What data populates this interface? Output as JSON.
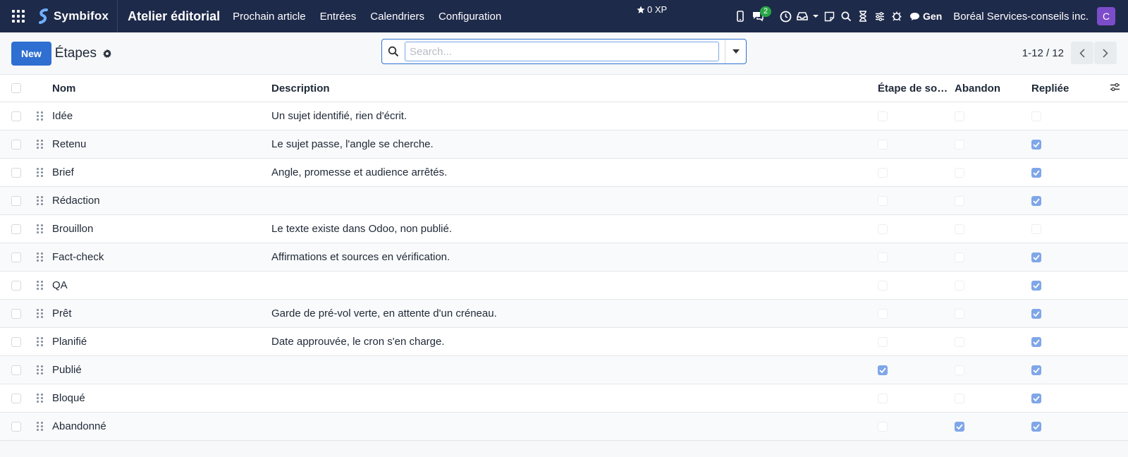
{
  "navbar": {
    "brand": "Symbifox",
    "app_name": "Atelier éditorial",
    "menu": [
      "Prochain article",
      "Entrées",
      "Calendriers",
      "Configuration"
    ],
    "xp": "0 XP",
    "chat_badge": "2",
    "gen_label": "Gen",
    "company": "Boréal Services-conseils inc.",
    "avatar": "C"
  },
  "control": {
    "new_label": "New",
    "title": "Étapes",
    "search_placeholder": "Search...",
    "pager_value": "1-12 / 12"
  },
  "table": {
    "headers": {
      "name": "Nom",
      "description": "Description",
      "exit": "Étape de sortie",
      "abandon": "Abandon",
      "folded": "Repliée"
    },
    "rows": [
      {
        "name": "Idée",
        "description": "Un sujet identifié, rien d'écrit.",
        "exit": false,
        "abandon": false,
        "folded": false
      },
      {
        "name": "Retenu",
        "description": "Le sujet passe, l'angle se cherche.",
        "exit": false,
        "abandon": false,
        "folded": true
      },
      {
        "name": "Brief",
        "description": "Angle, promesse et audience arrêtés.",
        "exit": false,
        "abandon": false,
        "folded": true
      },
      {
        "name": "Rédaction",
        "description": "",
        "exit": false,
        "abandon": false,
        "folded": true
      },
      {
        "name": "Brouillon",
        "description": "Le texte existe dans Odoo, non publié.",
        "exit": false,
        "abandon": false,
        "folded": false
      },
      {
        "name": "Fact-check",
        "description": "Affirmations et sources en vérification.",
        "exit": false,
        "abandon": false,
        "folded": true
      },
      {
        "name": "QA",
        "description": "",
        "exit": false,
        "abandon": false,
        "folded": true
      },
      {
        "name": "Prêt",
        "description": "Garde de pré-vol verte, en attente d'un créneau.",
        "exit": false,
        "abandon": false,
        "folded": true
      },
      {
        "name": "Planifié",
        "description": "Date approuvée, le cron s'en charge.",
        "exit": false,
        "abandon": false,
        "folded": true
      },
      {
        "name": "Publié",
        "description": "",
        "exit": true,
        "abandon": false,
        "folded": true
      },
      {
        "name": "Bloqué",
        "description": "",
        "exit": false,
        "abandon": false,
        "folded": true
      },
      {
        "name": "Abandonné",
        "description": "",
        "exit": false,
        "abandon": true,
        "folded": true
      }
    ]
  }
}
